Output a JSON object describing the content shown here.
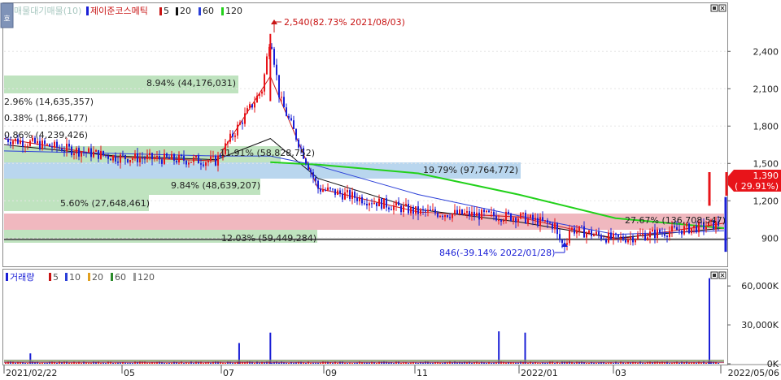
{
  "colors": {
    "up": "#e8141a",
    "down": "#1a1fd6",
    "ma5": "#c81414",
    "ma20": "#111111",
    "ma60": "#2b3fd8",
    "ma120": "#22d11a",
    "vp_buy": "#f0b8bf",
    "vp_sell": "#b9d6ee",
    "vp_green": "#bfe3bf",
    "current": "#e8141a"
  },
  "price_panel": {
    "corner_button": "호",
    "legend": {
      "hint_text": "매물대기매물(10)",
      "stock_name": "제이준코스메틱",
      "items": [
        {
          "label": "5",
          "color": "#c81414"
        },
        {
          "label": "20",
          "color": "#111111"
        },
        {
          "label": "60",
          "color": "#2b3fd8"
        },
        {
          "label": "120",
          "color": "#22d11a"
        }
      ]
    },
    "current_price": "1,390",
    "current_change": "( 29.91%)",
    "max_annotation": "2,540(82.73% 2021/08/03)",
    "min_annotation": "846(-39.14% 2022/01/28)",
    "profile_labels": [
      "8.94% (44,176,031)",
      "2.96% (14,635,357)",
      "0.38% (1,866,177)",
      "0.86% (4,239,426)",
      "11.91% (58,828,752)",
      "9.84% (48,639,207)",
      "19.79% (97,764,772)",
      "5.60% (27,648,461)",
      "27.67% (136,708,547)",
      "12.03% (59,449,284)"
    ]
  },
  "volume_panel": {
    "legend": {
      "title": "거래량",
      "items": [
        {
          "label": "5",
          "color": "#c81414"
        },
        {
          "label": "10",
          "color": "#2b3fd8"
        },
        {
          "label": "20",
          "color": "#e0a020"
        },
        {
          "label": "60",
          "color": "#2a8a2a"
        },
        {
          "label": "120",
          "color": "#999999"
        }
      ]
    }
  },
  "x_axis_labels": [
    "2021/02/22",
    "05",
    "07",
    "09",
    "11",
    "2022/01",
    "03",
    "2022/05/06"
  ],
  "chart_data": {
    "type": "candlestick",
    "title": "제이준코스메틱",
    "x_range": [
      "2021/02/22",
      "2022/05/06"
    ],
    "price_axis": {
      "ticks": [
        900,
        1200,
        1500,
        1800,
        2100,
        2400
      ],
      "tick_labels": [
        "900",
        "1,200",
        "1,500",
        "1,800",
        "2,100",
        "2,400"
      ],
      "ylim": [
        680,
        2780
      ]
    },
    "volume_axis": {
      "ticks": [
        0,
        30000,
        60000
      ],
      "tick_labels": [
        "0K",
        "30,000K",
        "60,000K"
      ],
      "ylim": [
        0,
        72000
      ]
    },
    "series": [
      {
        "name": "5",
        "x": [
          "2021/02/22",
          "2021/05/01",
          "2021/07/01",
          "2021/08/03",
          "2021/09/01",
          "2021/11/01",
          "2022/01/01",
          "2022/03/01",
          "2022/05/06"
        ],
        "values": [
          1700,
          1550,
          1520,
          2200,
          1300,
          1110,
          1070,
          890,
          1020
        ]
      },
      {
        "name": "20",
        "x": [
          "2021/02/22",
          "2021/05/01",
          "2021/07/01",
          "2021/08/03",
          "2021/09/01",
          "2021/11/01",
          "2022/01/01",
          "2022/03/01",
          "2022/05/06"
        ],
        "values": [
          1650,
          1560,
          1530,
          1700,
          1380,
          1130,
          1030,
          900,
          980
        ]
      },
      {
        "name": "60",
        "x": [
          "2021/02/22",
          "2021/05/01",
          "2021/07/01",
          "2021/08/03",
          "2021/09/01",
          "2021/11/01",
          "2022/01/01",
          "2022/03/01",
          "2022/05/06"
        ],
        "values": [
          1600,
          1580,
          1560,
          1560,
          1480,
          1250,
          1080,
          930,
          960
        ]
      },
      {
        "name": "120",
        "x": [
          "2021/08/03",
          "2021/09/01",
          "2021/11/01",
          "2022/01/01",
          "2022/03/01",
          "2022/05/06"
        ],
        "values": [
          1510,
          1490,
          1420,
          1250,
          1060,
          980
        ]
      }
    ],
    "max": {
      "value": 2540,
      "pct": 82.73,
      "date": "2021/08/03"
    },
    "min": {
      "value": 846,
      "pct": -39.14,
      "date": "2022/01/28"
    },
    "last": {
      "value": 1390,
      "pct": 29.91
    },
    "volume_spikes": [
      {
        "x": "2021/03/10",
        "value": 8000
      },
      {
        "x": "2021/07/15",
        "value": 16000
      },
      {
        "x": "2021/08/03",
        "value": 24000
      },
      {
        "x": "2021/12/20",
        "value": 25000
      },
      {
        "x": "2022/01/05",
        "value": 24000
      },
      {
        "x": "2022/05/06",
        "value": 66000
      }
    ]
  }
}
